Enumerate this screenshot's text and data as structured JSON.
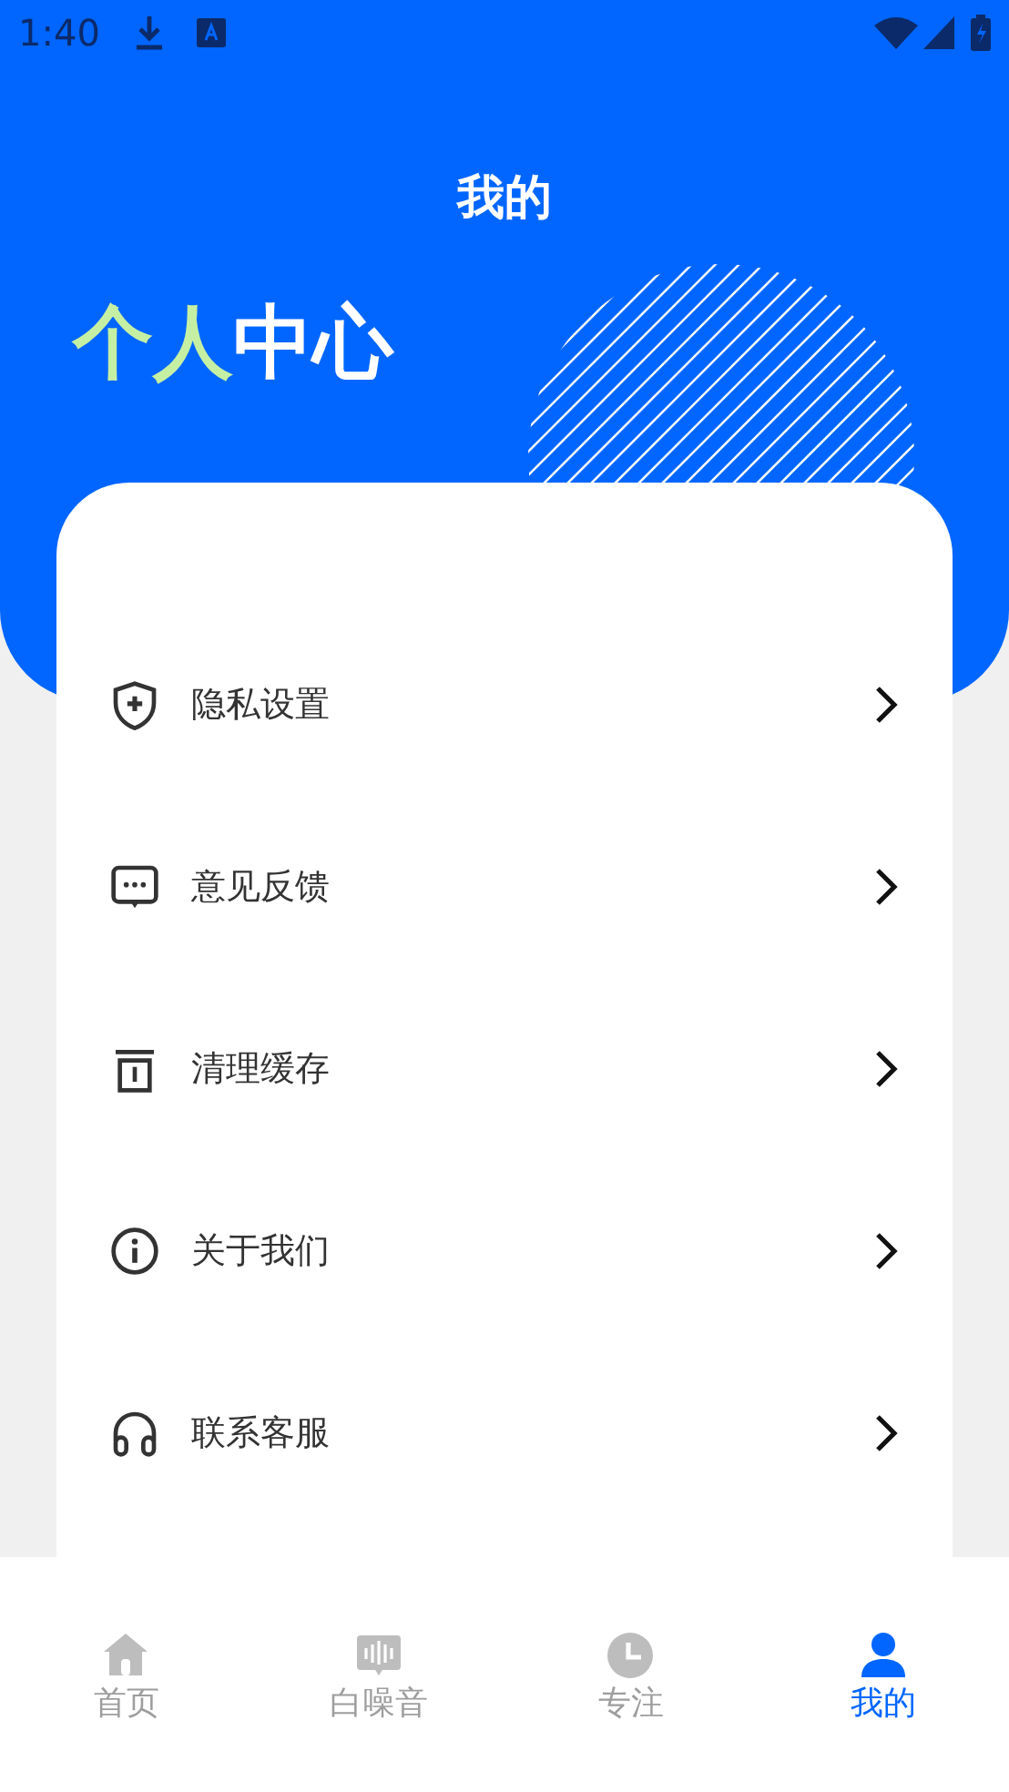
{
  "status_bar": {
    "time": "1:40"
  },
  "header": {
    "title": "我的",
    "heading": [
      {
        "text": "个人",
        "color": "#c5f0a4"
      },
      {
        "text": "中心",
        "color": "#ffffff"
      }
    ]
  },
  "menu": [
    {
      "kind": "shield",
      "label": "隐私设置"
    },
    {
      "kind": "chat",
      "label": "意见反馈"
    },
    {
      "kind": "trash",
      "label": "清理缓存"
    },
    {
      "kind": "info",
      "label": "关于我们"
    },
    {
      "kind": "headset",
      "label": "联系客服"
    }
  ],
  "tab_bar": [
    {
      "kind": "home",
      "label": "首页",
      "selected": false
    },
    {
      "kind": "sound",
      "label": "白噪音",
      "selected": false
    },
    {
      "kind": "clock",
      "label": "专注",
      "selected": false
    },
    {
      "kind": "person",
      "label": "我的",
      "selected": true
    }
  ]
}
